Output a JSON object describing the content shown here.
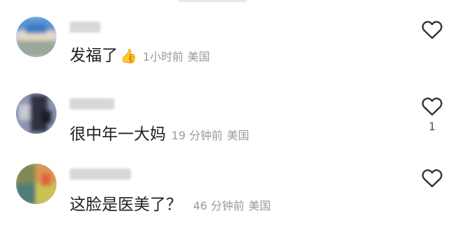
{
  "comments": [
    {
      "text": "发福了",
      "emoji": "👍",
      "time": "1小时前",
      "location": "美国",
      "likes": ""
    },
    {
      "text": "很中年一大妈",
      "emoji": "",
      "time": "19 分钟前",
      "location": "美国",
      "likes": "1"
    },
    {
      "text": "这脸是医美了？",
      "emoji": "",
      "time": "46 分钟前",
      "location": "美国",
      "likes": ""
    }
  ],
  "icons": {
    "like": "heart-outline-icon",
    "thumbs": "thumbs-up-emoji"
  }
}
